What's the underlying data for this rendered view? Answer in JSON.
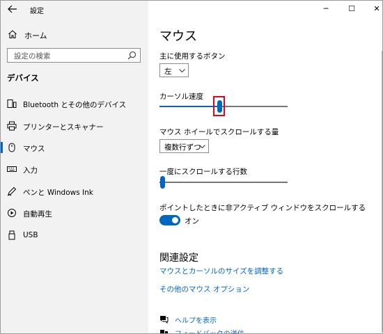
{
  "window": {
    "app_title": "設定",
    "controls": {
      "minimize": "─",
      "maximize": "☐",
      "close": "✕"
    }
  },
  "sidebar": {
    "home_label": "ホーム",
    "search_placeholder": "設定の検索",
    "section_title": "デバイス",
    "items": [
      {
        "label": "Bluetooth とその他のデバイス",
        "icon": "bluetooth-devices-icon",
        "selected": false
      },
      {
        "label": "プリンターとスキャナー",
        "icon": "printer-icon",
        "selected": false
      },
      {
        "label": "マウス",
        "icon": "mouse-icon",
        "selected": true
      },
      {
        "label": "入力",
        "icon": "keyboard-icon",
        "selected": false
      },
      {
        "label": "ペンと Windows Ink",
        "icon": "pen-icon",
        "selected": false
      },
      {
        "label": "自動再生",
        "icon": "autoplay-icon",
        "selected": false
      },
      {
        "label": "USB",
        "icon": "usb-icon",
        "selected": false
      }
    ]
  },
  "main": {
    "title": "マウス",
    "primary_button": {
      "label": "主に使用するボタン",
      "value": "左"
    },
    "cursor_speed": {
      "label": "カーソル速度",
      "value_fraction": 0.47
    },
    "wheel_scroll": {
      "label": "マウス ホイールでスクロールする量",
      "value": "複数行ずつ"
    },
    "lines_scroll": {
      "label": "一度にスクロールする行数",
      "value_fraction": 0.02
    },
    "inactive_scroll": {
      "label": "ポイントしたときに非アクティブ ウィンドウをスクロールする",
      "state": "オン",
      "on": true
    },
    "related": {
      "title": "関連設定",
      "links": [
        "マウスとカーソルのサイズを調整する",
        "その他のマウス オプション"
      ]
    },
    "help": [
      {
        "label": "ヘルプを表示",
        "icon": "help-chat-icon"
      },
      {
        "label": "フィードバックの送信",
        "icon": "feedback-icon"
      }
    ]
  },
  "colors": {
    "accent": "#0067c0",
    "highlight": "#e6001a",
    "sidebar_bg": "#f2f2f2"
  }
}
